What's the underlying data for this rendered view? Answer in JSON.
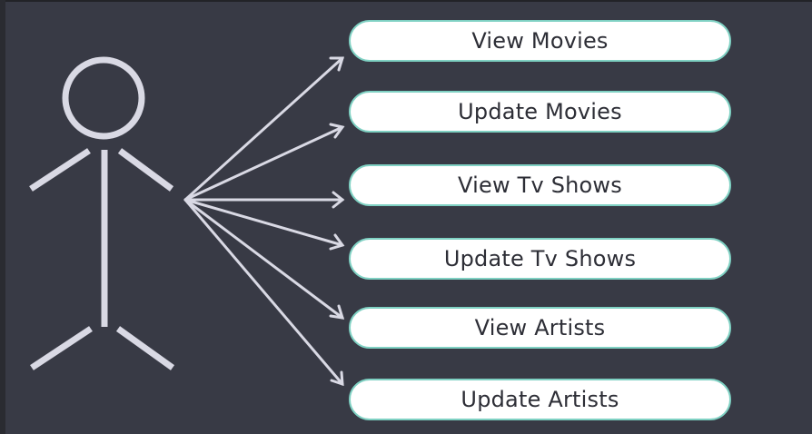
{
  "diagram": {
    "use_cases": [
      "View Movies",
      "Update Movies",
      "View Tv Shows",
      "Update Tv Shows",
      "View Artists",
      "Update Artists"
    ]
  }
}
